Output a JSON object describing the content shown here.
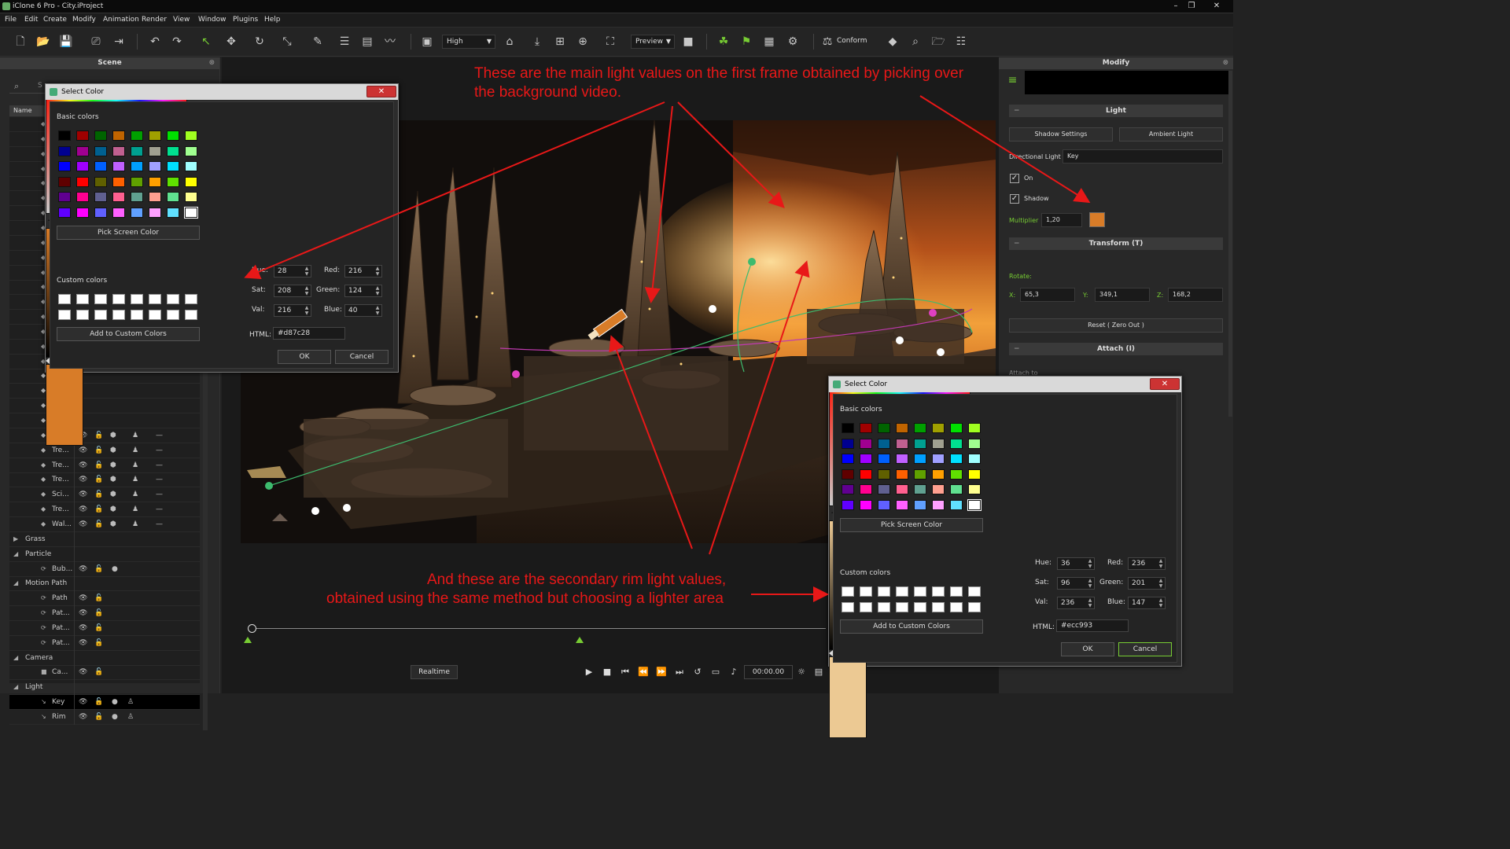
{
  "window": {
    "title": "iClone 6 Pro - City.iProject"
  },
  "menu": [
    "File",
    "Edit",
    "Create",
    "Modify",
    "Animation",
    "Render",
    "View",
    "Window",
    "Plugins",
    "Help"
  ],
  "toolbar": {
    "quality": "High",
    "preview": "Preview",
    "conform": "Conform"
  },
  "scene_panel": {
    "title": "Scene",
    "search_placeholder": "S",
    "name_col": "Name",
    "rows": [
      "Tre...",
      "Tre...",
      "Tre...",
      "Tre...",
      "Sci...",
      "Tre...",
      "Wal..."
    ],
    "grass": "Grass",
    "particle": "Particle",
    "particle_items": [
      "Bub..."
    ],
    "motion_path": "Motion Path",
    "path_items": [
      "Path",
      "Pat...",
      "Pat...",
      "Pat..."
    ],
    "camera": "Camera",
    "camera_items": [
      "Ca..."
    ],
    "light": "Light",
    "light_items": [
      "Key",
      "Rim"
    ]
  },
  "modify_panel": {
    "title": "Modify",
    "light_section": "Light",
    "shadow_settings": "Shadow Settings",
    "ambient_light": "Ambient Light",
    "directional_label": "Directional Light",
    "directional_value": "Key",
    "on": "On",
    "shadow": "Shadow",
    "multiplier_label": "Multiplier",
    "multiplier_value": "1,20",
    "multiplier_color": "#d87c28",
    "transform_section": "Transform  (T)",
    "rotate_label": "Rotate:",
    "x_label": "X:",
    "x_value": "65,3",
    "y_label": "Y:",
    "y_value": "349,1",
    "z_label": "Z:",
    "z_value": "168,2",
    "reset": "Reset ( Zero Out )",
    "attach_section": "Attach  (I)",
    "attach_to": "Attach to"
  },
  "playback": {
    "realtime": "Realtime",
    "timecode": "00:00.00"
  },
  "basic_colors": [
    "#000000",
    "#a00000",
    "#006400",
    "#c06400",
    "#00a000",
    "#a0a000",
    "#00e000",
    "#a0ff20",
    "#000090",
    "#a00090",
    "#006090",
    "#c06090",
    "#00a090",
    "#a0a090",
    "#00e090",
    "#a0ff90",
    "#0000ff",
    "#a000ff",
    "#0060ff",
    "#c060ff",
    "#00a0ff",
    "#a0a0ff",
    "#00e0ff",
    "#a0ffff",
    "#600000",
    "#ff0000",
    "#606000",
    "#ff6000",
    "#60a000",
    "#ffa000",
    "#60e000",
    "#ffff00",
    "#600090",
    "#ff0090",
    "#606090",
    "#ff6090",
    "#60a090",
    "#ffa090",
    "#60e090",
    "#ffff90",
    "#6000ff",
    "#ff00ff",
    "#6060ff",
    "#ff60ff",
    "#60a0ff",
    "#ffa0ff",
    "#60e0ff",
    "#ffffff"
  ],
  "dialog1": {
    "title": "Select Color",
    "basic_colors": "Basic colors",
    "pick_screen": "Pick Screen Color",
    "custom_colors": "Custom colors",
    "add_custom": "Add to Custom Colors",
    "hue_label": "Hue:",
    "hue": "28",
    "sat_label": "Sat:",
    "sat": "208",
    "val_label": "Val:",
    "val": "216",
    "red_label": "Red:",
    "red": "216",
    "green_label": "Green:",
    "green": "124",
    "blue_label": "Blue:",
    "blue": "40",
    "html_label": "HTML:",
    "html": "#d87c28",
    "ok": "OK",
    "cancel": "Cancel",
    "preview_color": "#d87c28",
    "hue_strip_color": "#d87c28"
  },
  "dialog2": {
    "title": "Select Color",
    "basic_colors": "Basic colors",
    "pick_screen": "Pick Screen Color",
    "custom_colors": "Custom colors",
    "add_custom": "Add to Custom Colors",
    "hue_label": "Hue:",
    "hue": "36",
    "sat_label": "Sat:",
    "sat": "96",
    "val_label": "Val:",
    "val": "236",
    "red_label": "Red:",
    "red": "236",
    "green_label": "Green:",
    "green": "201",
    "blue_label": "Blue:",
    "blue": "147",
    "html_label": "HTML:",
    "html": "#ecc993",
    "ok": "OK",
    "cancel": "Cancel",
    "preview_color": "#ecc993",
    "hue_strip_color": "#ecc993"
  },
  "annotations": {
    "top_line1": "These are the main light values on the first frame obtained by picking over",
    "top_line2": "the background video.",
    "bottom_line1": "And these are the secondary rim light values,",
    "bottom_line2": "obtained using the same method but choosing a lighter area"
  },
  "accent_color": "#e81818"
}
